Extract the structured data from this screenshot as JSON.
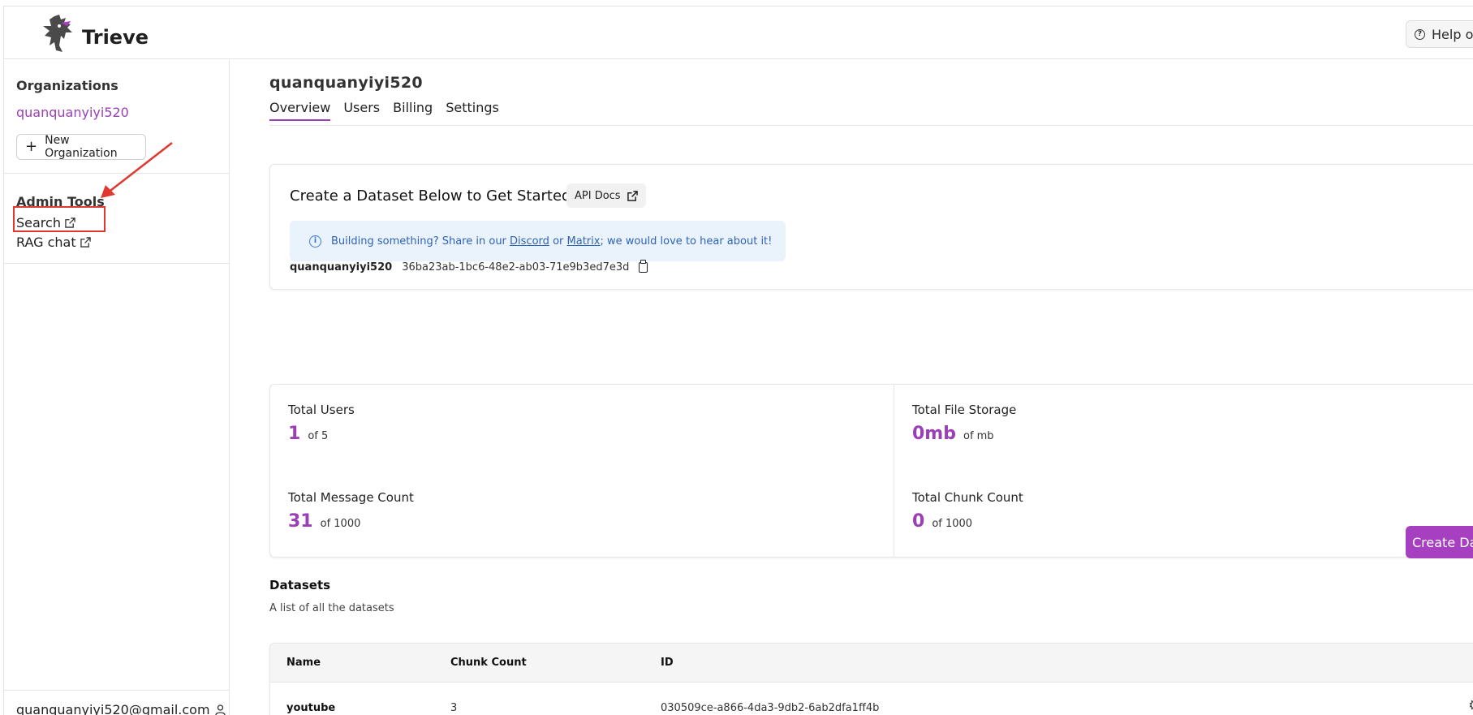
{
  "app": {
    "brand": "Trieve",
    "help_label": "Help or C"
  },
  "sidebar": {
    "organizations_title": "Organizations",
    "org_name": "quanquanyiyi520",
    "new_org_label": "New Organization",
    "admin_tools_title": "Admin Tools",
    "links": [
      {
        "label": "Search"
      },
      {
        "label": "RAG chat"
      }
    ],
    "user_email": "quanquanyiyi520@gmail.com"
  },
  "main": {
    "org_title": "quanquanyiyi520",
    "tabs": [
      {
        "label": "Overview"
      },
      {
        "label": "Users"
      },
      {
        "label": "Billing"
      },
      {
        "label": "Settings"
      }
    ],
    "create_card": {
      "title": "Create a Dataset Below to Get Started!",
      "api_docs": "API Docs",
      "info_prefix": "Building something? Share in our",
      "info_link1": "Discord",
      "info_or": "or",
      "info_link2": "Matrix",
      "info_suffix": "; we would love to hear about it!",
      "org_name": "quanquanyiyi520",
      "org_id": "36ba23ab-1bc6-48e2-ab03-71e9b3ed7e3d"
    },
    "stats": [
      {
        "label": "Total Users",
        "value": "1",
        "of": "of 5"
      },
      {
        "label": "Total File Storage",
        "value": "0mb",
        "of": "of mb"
      },
      {
        "label": "Total Message Count",
        "value": "31",
        "of": "of 1000"
      },
      {
        "label": "Total Chunk Count",
        "value": "0",
        "of": "of 1000"
      }
    ],
    "datasets": {
      "title": "Datasets",
      "subtitle": "A list of all the datasets",
      "create_button": "Create Dat",
      "columns": [
        "Name",
        "Chunk Count",
        "ID"
      ],
      "rows": [
        {
          "name": "youtube",
          "chunk_count": "3",
          "id": "030509ce-a866-4da3-9db2-6ab2dfa1ff4b"
        }
      ]
    }
  },
  "colors": {
    "accent": "#9a3fb5",
    "button": "#a63fc0",
    "annotation": "#e0382f"
  }
}
